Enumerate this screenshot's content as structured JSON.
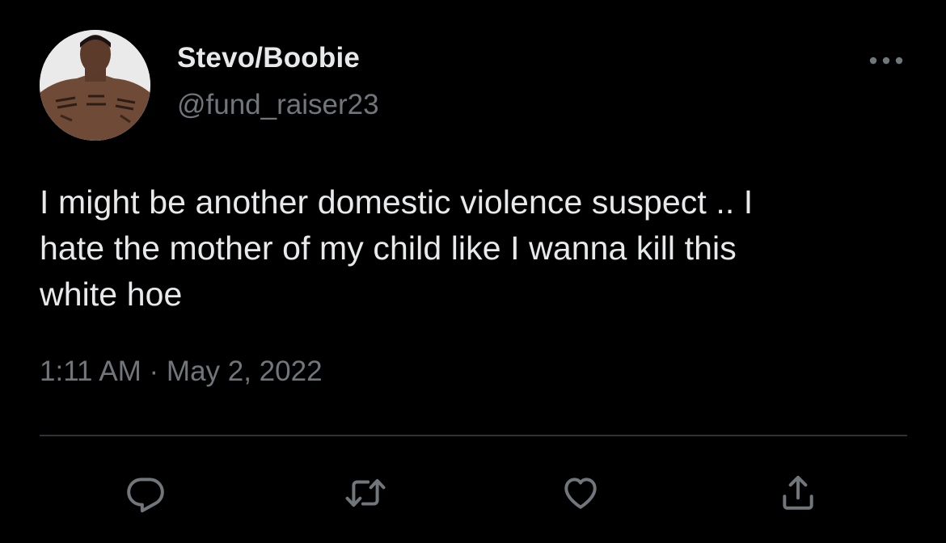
{
  "tweet": {
    "author": {
      "display_name": "Stevo/Boobie",
      "handle": "@fund_raiser23",
      "avatar_icon": "profile-photo"
    },
    "text": "I might be another domestic violence suspect .. I\nhate the mother of my child like I wanna kill this\nwhite hoe",
    "timestamp": "1:11 AM · May 2, 2022",
    "menu_icon": "more-horizontal-icon"
  },
  "actions": [
    {
      "name": "reply",
      "icon": "reply-icon"
    },
    {
      "name": "retweet",
      "icon": "retweet-icon"
    },
    {
      "name": "like",
      "icon": "heart-icon"
    },
    {
      "name": "share",
      "icon": "share-icon"
    }
  ],
  "colors": {
    "background": "#000000",
    "primary_text": "#e7e9ea",
    "secondary_text": "#71767b",
    "divider": "#2f3336"
  }
}
